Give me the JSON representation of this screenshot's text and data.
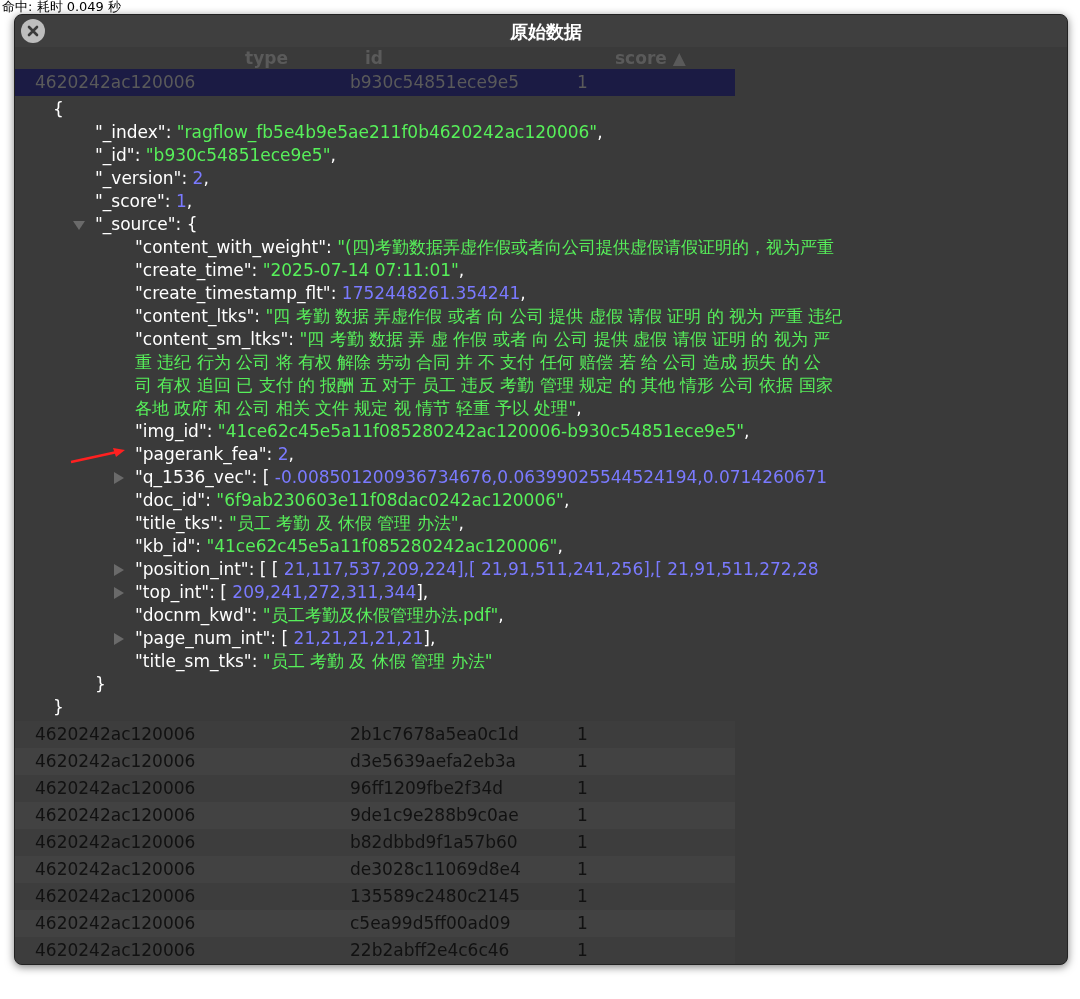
{
  "status_text": "命中: 耗时 0.049 秒",
  "window": {
    "title": "原始数据"
  },
  "table": {
    "columns": [
      "type",
      "id",
      "score"
    ],
    "sort_indicator": "▲",
    "rows": [
      {
        "column_1": "4620242ac120006",
        "id": "b930c54851ece9e5",
        "score": "1",
        "selected": true
      },
      {
        "column_1": "4620242ac120006",
        "id": "2b1c7678a5ea0c1d",
        "score": "1",
        "selected": false
      },
      {
        "column_1": "4620242ac120006",
        "id": "d3e5639aefa2eb3a",
        "score": "1",
        "selected": false
      },
      {
        "column_1": "4620242ac120006",
        "id": "96ff1209fbe2f34d",
        "score": "1",
        "selected": false
      },
      {
        "column_1": "4620242ac120006",
        "id": "9de1c9e288b9c0ae",
        "score": "1",
        "selected": false
      },
      {
        "column_1": "4620242ac120006",
        "id": "b82dbbd9f1a57b60",
        "score": "1",
        "selected": false
      },
      {
        "column_1": "4620242ac120006",
        "id": "de3028c11069d8e4",
        "score": "1",
        "selected": false
      },
      {
        "column_1": "4620242ac120006",
        "id": "135589c2480c2145",
        "score": "1",
        "selected": false
      },
      {
        "column_1": "4620242ac120006",
        "id": "c5ea99d5ff00ad09",
        "score": "1",
        "selected": false
      },
      {
        "column_1": "4620242ac120006",
        "id": "22b2abff2e4c6c46",
        "score": "1",
        "selected": false
      }
    ]
  },
  "tree": {
    "open": "{",
    "close": "}",
    "children": [
      {
        "kind": "string",
        "key": "\"_index\": ",
        "value": "\"ragflow_fb5e4b9e5ae211f0b4620242ac120006\"",
        "suffix": ","
      },
      {
        "kind": "string",
        "key": "\"_id\": ",
        "value": "\"b930c54851ece9e5\"",
        "suffix": ","
      },
      {
        "kind": "number",
        "key": "\"_version\": ",
        "value": "2",
        "suffix": ","
      },
      {
        "kind": "number",
        "key": "\"_score\": ",
        "value": "1",
        "suffix": ","
      },
      {
        "kind": "object",
        "key": "\"_source\": ",
        "open": "{",
        "close": "}",
        "expanded": true,
        "children": [
          {
            "kind": "string",
            "key": "\"content_with_weight\": ",
            "value": "\"(四)考勤数据弄虚作假或者向公司提供虚假请假证明的，视为严重"
          },
          {
            "kind": "string",
            "key": "\"create_time\": ",
            "value": "\"2025-07-14 07:11:01\"",
            "suffix": ","
          },
          {
            "kind": "number",
            "key": "\"create_timestamp_flt\": ",
            "value": "1752448261.354241",
            "suffix": ","
          },
          {
            "kind": "string",
            "key": "\"content_ltks\": ",
            "value": "\"四 考勤 数据 弄虚作假 或者 向 公司 提供 虚假 请假 证明 的 视为 严重 违纪"
          },
          {
            "kind": "string",
            "key": "\"content_sm_ltks\": ",
            "value_lines": [
              "\"四 考勤 数据 弄 虚 作假 或者 向 公司 提供 虚假 请假 证明 的 视为 严",
              "重 违纪 行为 公司 将 有权 解除 劳动 合同 并 不 支付 任何 赔偿 若 给 公司 造成 损失 的 公",
              "司 有权 追回 已 支付 的 报酬 五 对于 员工 违反 考勤 管理 规定 的 其他 情形 公司 依据 国家",
              "各地 政府 和 公司 相关 文件 规定 视 情节 轻重 予以 处理\""
            ],
            "suffix": ","
          },
          {
            "kind": "string",
            "key": "\"img_id\": ",
            "value": "\"41ce62c45e5a11f085280242ac120006-b930c54851ece9e5\"",
            "suffix": ","
          },
          {
            "kind": "number",
            "key": "\"pagerank_fea\": ",
            "value": "2",
            "suffix": ",",
            "marked": true
          },
          {
            "kind": "array",
            "key": "\"q_1536_vec\": ",
            "open": "[ ",
            "value": "-0.008501200936734676,0.06399025544524194,0.0714260671",
            "expanded": false
          },
          {
            "kind": "string",
            "key": "\"doc_id\": ",
            "value": "\"6f9ab230603e11f08dac0242ac120006\"",
            "suffix": ","
          },
          {
            "kind": "string",
            "key": "\"title_tks\": ",
            "value": "\"员工 考勤 及 休假 管理 办法\"",
            "suffix": ","
          },
          {
            "kind": "string",
            "key": "\"kb_id\": ",
            "value": "\"41ce62c45e5a11f085280242ac120006\"",
            "suffix": ","
          },
          {
            "kind": "array",
            "key": "\"position_int\": ",
            "open": "[ [ ",
            "value": "21,117,537,209,224],[ 21,91,511,241,256],[ 21,91,511,272,28",
            "expanded": false
          },
          {
            "kind": "array",
            "key": "\"top_int\": ",
            "open": "[ ",
            "value": "209,241,272,311,344",
            "close": "],",
            "expanded": false
          },
          {
            "kind": "string",
            "key": "\"docnm_kwd\": ",
            "value": "\"员工考勤及休假管理办法.pdf\"",
            "suffix": ","
          },
          {
            "kind": "array",
            "key": "\"page_num_int\": ",
            "open": "[ ",
            "value": "21,21,21,21,21",
            "close": "],",
            "expanded": false
          },
          {
            "kind": "string",
            "key": "\"title_sm_tks\": ",
            "value": "\"员工 考勤 及 休假 管理 办法\""
          }
        ]
      }
    ]
  }
}
